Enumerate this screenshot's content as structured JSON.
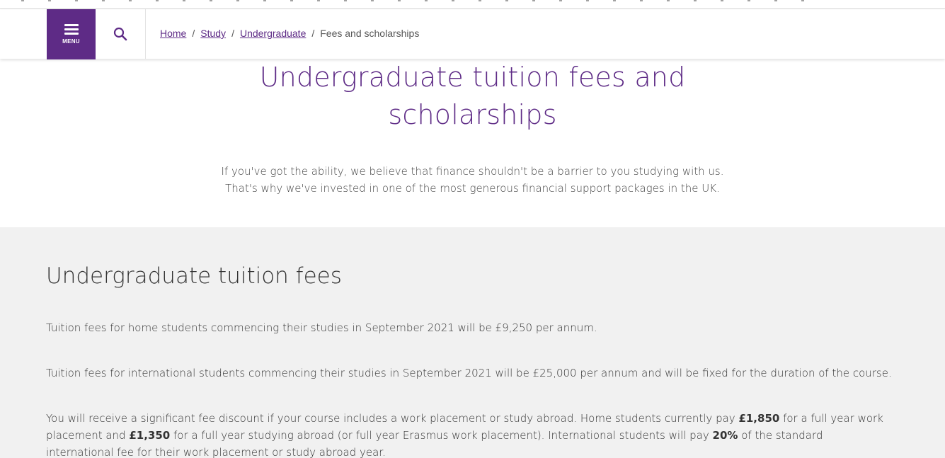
{
  "header": {
    "menu_label": "MENU",
    "breadcrumb": {
      "home": "Home",
      "study": "Study",
      "undergraduate": "Undergraduate",
      "current": "Fees and scholarships",
      "separator": "/"
    }
  },
  "hero": {
    "title": "Undergraduate tuition fees and scholarships",
    "intro": "If you've got the ability, we believe that finance shouldn't be a barrier to you studying with us. That's why we've invested in one of the most generous financial support packages in the UK."
  },
  "fees": {
    "heading": "Undergraduate tuition fees",
    "home_fee_text": "Tuition fees for home students commencing their studies in September 2021 will be £9,250 per annum.",
    "international_fee_text": "Tuition fees for international students commencing their studies in September 2021 will be £25,000 per annum and will be fixed for the duration of the course.",
    "discount": {
      "part1": "You will receive a significant fee discount if your course includes a work placement or study abroad. Home students currently pay ",
      "amount1": "£1,850",
      "part2": " for a full year work placement and ",
      "amount2": "£1,350",
      "part3": " for a full year studying abroad (or full year Erasmus work placement). International students will pay ",
      "percent": "20%",
      "part4": " of the standard international fee for their work placement or study abroad year."
    }
  },
  "colors": {
    "brand_purple": "#5e2b86",
    "section_grey": "#f1f1f1"
  },
  "icons": {
    "menu": "hamburger-icon",
    "search": "search-icon"
  }
}
